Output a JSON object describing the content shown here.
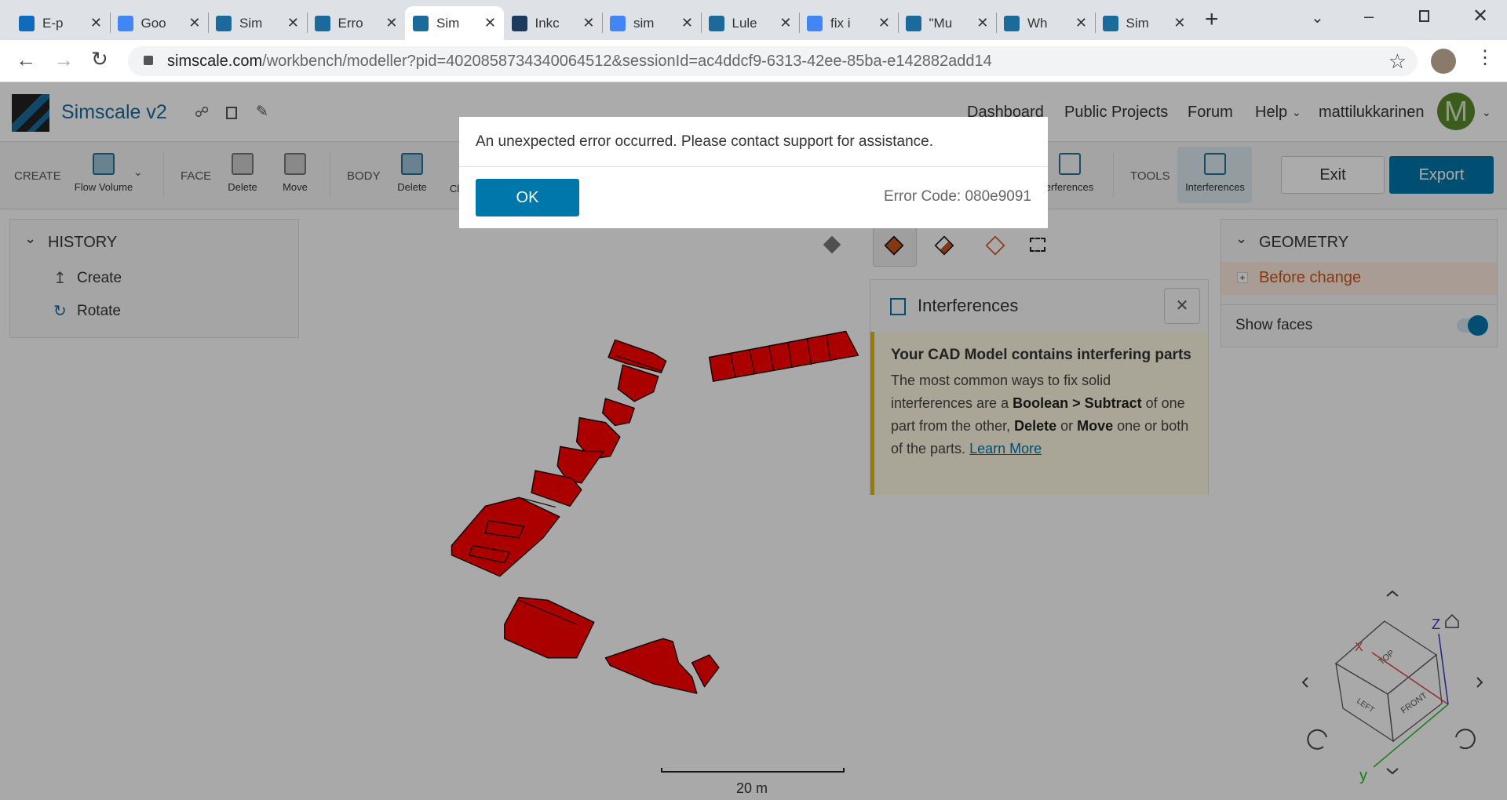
{
  "browser": {
    "tabs": [
      {
        "title": "E-p",
        "icon": "outlook-icon",
        "color": "#0f6cbd"
      },
      {
        "title": "Goo",
        "icon": "google-icon",
        "color": "#4285f4"
      },
      {
        "title": "Sim",
        "icon": "simscale-icon",
        "color": "#1a6b9c"
      },
      {
        "title": "Erro",
        "icon": "simscale-icon",
        "color": "#1a6b9c"
      },
      {
        "title": "Sim",
        "icon": "simscale-icon",
        "color": "#1a6b9c"
      },
      {
        "title": "Inkc",
        "icon": "linkedin-style-icon",
        "color": "#1b3a5c"
      },
      {
        "title": "sim",
        "icon": "google-icon",
        "color": "#4285f4"
      },
      {
        "title": "Lule",
        "icon": "simscale-icon",
        "color": "#1a6b9c"
      },
      {
        "title": "fix i",
        "icon": "google-icon",
        "color": "#4285f4"
      },
      {
        "title": "\"Mu",
        "icon": "simscale-icon",
        "color": "#1a6b9c"
      },
      {
        "title": "Wh",
        "icon": "simscale-icon",
        "color": "#1a6b9c"
      },
      {
        "title": "Sim",
        "icon": "simscale-icon",
        "color": "#1a6b9c"
      }
    ],
    "active_tab": 4,
    "url_host": "simscale.com",
    "url_path": "/workbench/modeller?pid=4020858734340064512&sessionId=ac4ddcf9-6313-42ee-85ba-e142882add14"
  },
  "app": {
    "title": "Simscale v2",
    "nav": [
      "Dashboard",
      "Public Projects",
      "Forum",
      "Help"
    ],
    "username": "mattilukkarinen",
    "avatar_letter": "M",
    "avatar_color": "#5a8a2e",
    "toolbar": {
      "create_label": "CREATE",
      "flow_volume": "Flow Volume",
      "face_label": "FACE",
      "face_delete": "Delete",
      "face_move": "Move",
      "body_label": "BODY",
      "body_delete": "Delete",
      "body_clone": "Cl",
      "interferences_partial": "erferences",
      "tools_label": "TOOLS",
      "interferences": "Interferences",
      "exit": "Exit",
      "export": "Export"
    },
    "history": {
      "title": "HISTORY",
      "items": [
        "Create",
        "Rotate"
      ]
    },
    "geometry": {
      "title": "GEOMETRY",
      "item": "Before change",
      "show_faces": "Show faces",
      "show_faces_on": true
    },
    "interferences_panel": {
      "title": "Interferences",
      "heading": "Your CAD Model contains interfering parts",
      "t1": "The most common ways to fix solid interferences are a ",
      "b1": "Boolean > Subtract",
      "t2": " of one part from the other, ",
      "b2": "Delete",
      "t3": " or ",
      "b3": "Move",
      "t4": " one or both of the parts. ",
      "link": "Learn More"
    },
    "scale_label": "20 m",
    "viewcube": {
      "top": "TOP",
      "front": "FRONT",
      "left": "LEFT",
      "x": "X",
      "y": "y",
      "z": "Z"
    }
  },
  "dialog": {
    "message": "An unexpected error occurred. Please contact support for assistance.",
    "ok": "OK",
    "error_code": "Error Code: 080e9091"
  },
  "colors": {
    "accent": "#0077aa",
    "model": "#ff0000",
    "warning_bar": "#e6b800"
  }
}
